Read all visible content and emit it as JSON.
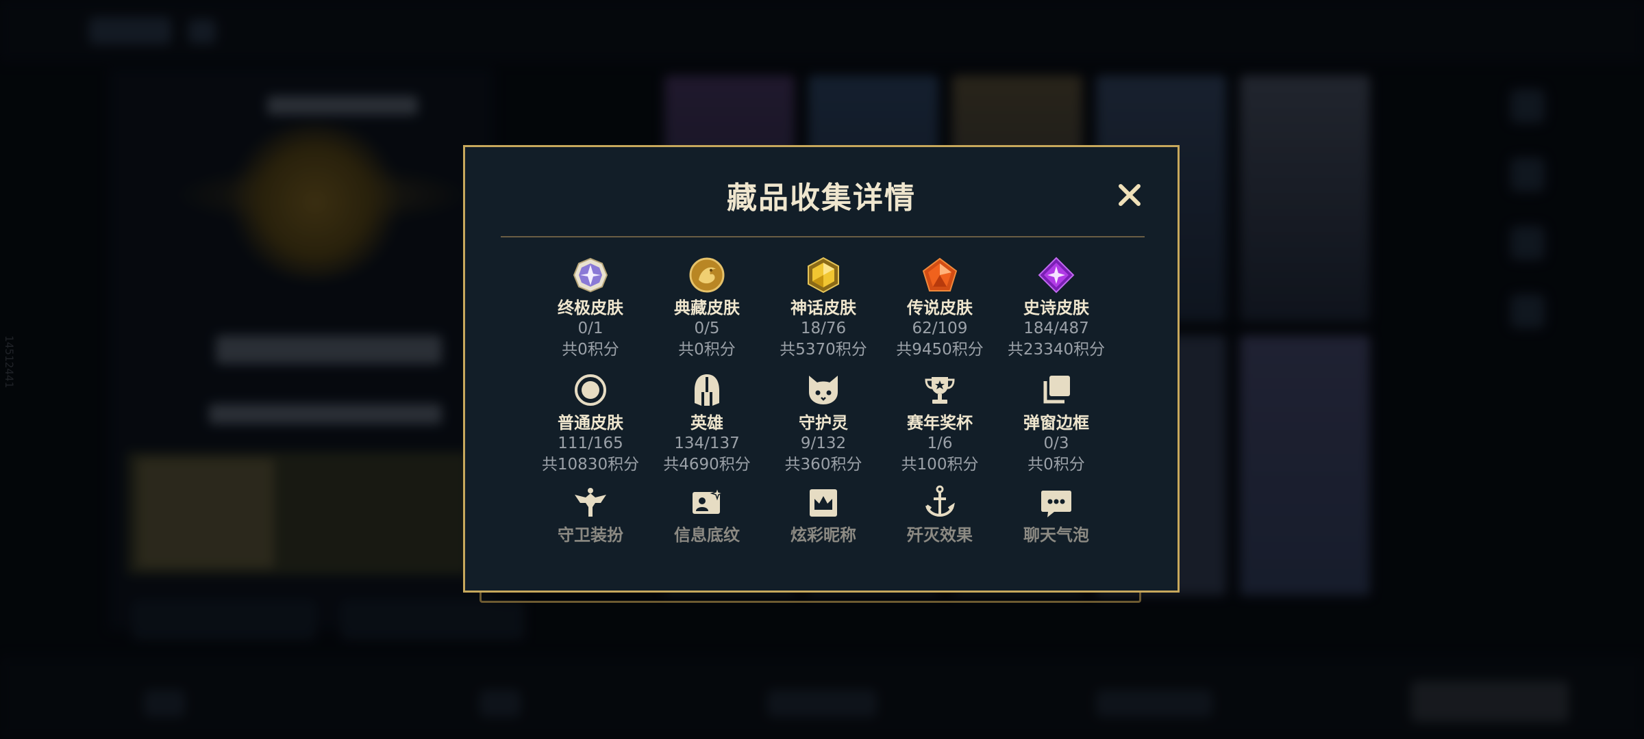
{
  "side_id": "14512441",
  "modal": {
    "title": "藏品收集详情",
    "close_label": "✕"
  },
  "categories": [
    {
      "name": "终极皮肤",
      "count": "0/1",
      "points": "共0积分",
      "icon": "ultimate-gem-icon"
    },
    {
      "name": "典藏皮肤",
      "count": "0/5",
      "points": "共0积分",
      "icon": "dragon-medallion-icon"
    },
    {
      "name": "神话皮肤",
      "count": "18/76",
      "points": "共5370积分",
      "icon": "mythic-hexagon-icon"
    },
    {
      "name": "传说皮肤",
      "count": "62/109",
      "points": "共9450积分",
      "icon": "legendary-pentagon-icon"
    },
    {
      "name": "史诗皮肤",
      "count": "184/487",
      "points": "共23340积分",
      "icon": "epic-diamond-icon"
    },
    {
      "name": "普通皮肤",
      "count": "111/165",
      "points": "共10830积分",
      "icon": "ring-icon"
    },
    {
      "name": "英雄",
      "count": "134/137",
      "points": "共4690积分",
      "icon": "helmet-icon"
    },
    {
      "name": "守护灵",
      "count": "9/132",
      "points": "共360积分",
      "icon": "pet-face-icon"
    },
    {
      "name": "赛年奖杯",
      "count": "1/6",
      "points": "共100积分",
      "icon": "trophy-icon"
    },
    {
      "name": "弹窗边框",
      "count": "0/3",
      "points": "共0积分",
      "icon": "stacked-frames-icon"
    },
    {
      "name": "守卫装扮",
      "icon": "ward-icon"
    },
    {
      "name": "信息底纹",
      "icon": "profile-card-icon"
    },
    {
      "name": "炫彩昵称",
      "icon": "crown-banner-icon"
    },
    {
      "name": "歼灭效果",
      "icon": "anchor-icon"
    },
    {
      "name": "聊天气泡",
      "icon": "chat-bubble-icon"
    }
  ],
  "colors": {
    "accent_gold": "#c7a85c",
    "modal_bg": "#121e28",
    "title_text": "#efe6ce",
    "muted_text": "#9ba1a8"
  }
}
